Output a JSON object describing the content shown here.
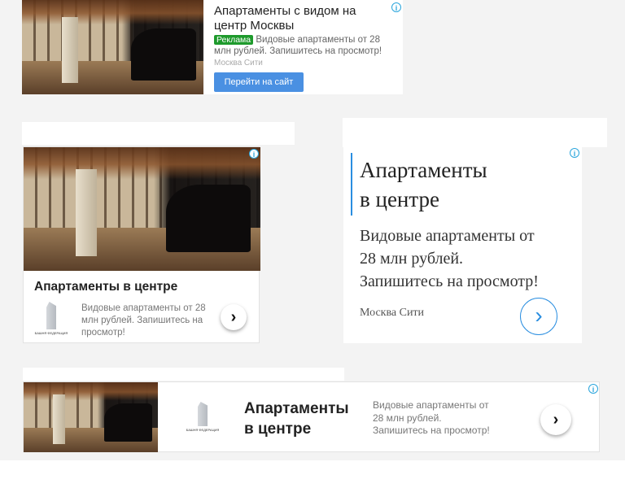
{
  "ad1": {
    "title": "Апартаменты с видом на центр Москвы",
    "badge": "Реклама",
    "badge_color": "#1e9a2c",
    "text": "Видовые апартаменты от 28 млн рублей. Запишитесь на просмотр!",
    "domain": "Москва Сити",
    "button": "Перейти на сайт",
    "button_color": "#4a90e2",
    "info_icon": "info-icon"
  },
  "ad2": {
    "title": "Апартаменты в центре",
    "text": "Видовые апартаменты от 28 млн рублей. Запишитесь на просмотр!",
    "logo_text": "БАШНЯ ФЕДЕРАЦИЯ",
    "arrow_icon": "chevron-right-icon"
  },
  "ad3": {
    "title_line1": "Апартаменты",
    "title_line2": "в центре",
    "text_line1": "Видовые апартаменты от",
    "text_line2": "28 млн рублей.",
    "text_line3": "Запишитесь на просмотр!",
    "domain": "Москва Сити",
    "accent": "#2a8ee0"
  },
  "ad4": {
    "title_line1": "Апартаменты",
    "title_line2": "в центре",
    "text_line1": "Видовые апартаменты от",
    "text_line2": "28 млн рублей.",
    "text_line3": "Запишитесь на просмотр!",
    "logo_text": "БАШНЯ ФЕДЕРАЦИЯ"
  }
}
